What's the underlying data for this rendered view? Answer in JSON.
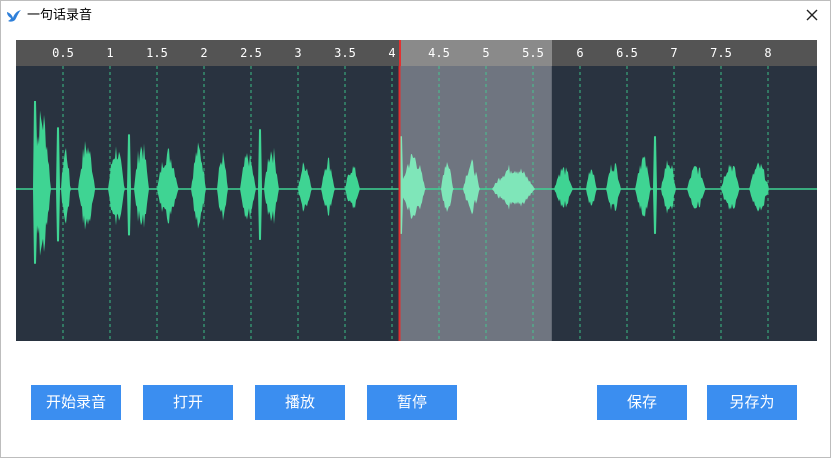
{
  "window": {
    "title": "一句话录音"
  },
  "icons": {
    "app": "bird-icon",
    "close": "close-icon"
  },
  "colors": {
    "accent": "#3b8ef0",
    "waveform": "#3fd493",
    "waveform_selected": "#7fe6b9",
    "canvas": "#293340",
    "ruler": "#545454",
    "ruler_selected": "#8a8a8a",
    "playhead": "#e23030",
    "grid": "#3fd493"
  },
  "timeline": {
    "ticks": [
      "0.5",
      "1",
      "1.5",
      "2",
      "2.5",
      "3",
      "3.5",
      "4",
      "4.5",
      "5",
      "5.5",
      "6",
      "6.5",
      "7",
      "7.5",
      "8"
    ],
    "playhead_seconds": 4.08,
    "selection_seconds": [
      4.08,
      5.7
    ]
  },
  "buttons": {
    "record": "开始录音",
    "open": "打开",
    "play": "播放",
    "pause": "暂停",
    "save": "保存",
    "save_as": "另存为"
  }
}
